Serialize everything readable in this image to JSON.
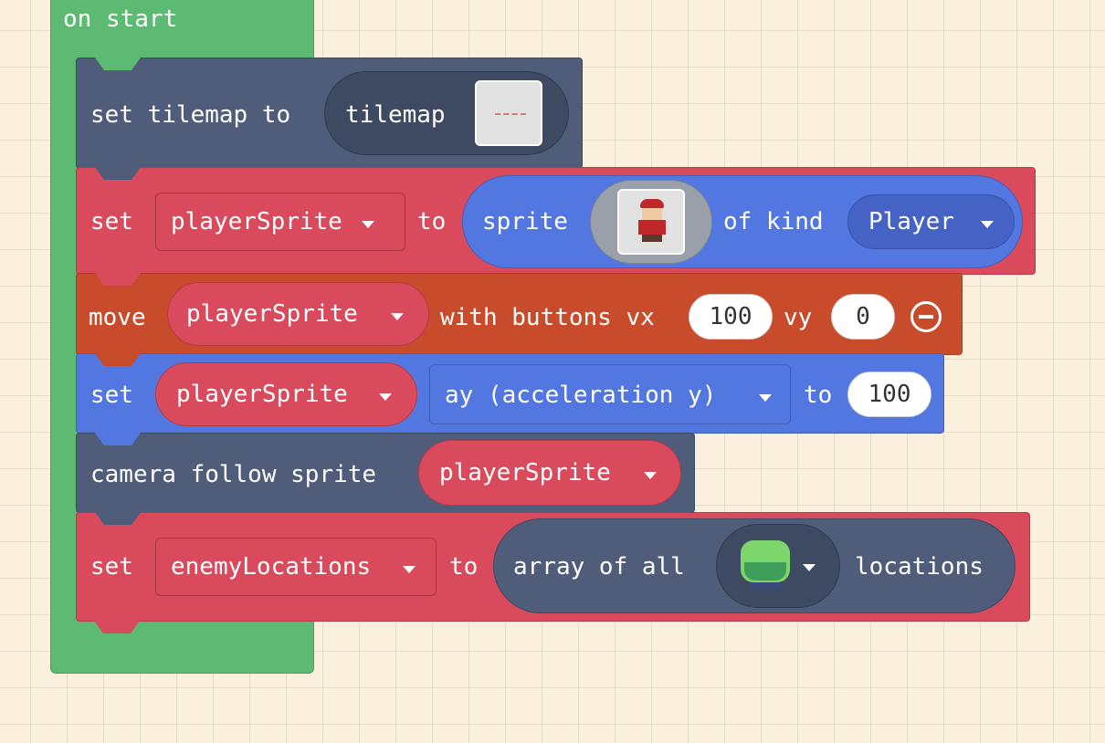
{
  "hat": {
    "label": "on start",
    "color": "#5cba73"
  },
  "blocks": {
    "tilemap": {
      "set_label": "set tilemap to",
      "value_label": "tilemap",
      "icon": "tilemap-thumbnail-icon"
    },
    "player_set": {
      "set_label": "set",
      "var": "playerSprite",
      "to_label": "to",
      "sprite_label": "sprite",
      "icon": "player-sprite-image-icon",
      "kind_label": "of kind",
      "kind": "Player"
    },
    "move": {
      "move_label": "move",
      "var": "playerSprite",
      "with_label": "with buttons vx",
      "vx": "100",
      "vy_label": "vy",
      "vy": "0",
      "icon": "minus-circle-icon"
    },
    "accel": {
      "set_label": "set",
      "var": "playerSprite",
      "prop": "ay (acceleration y)",
      "to_label": "to",
      "value": "100"
    },
    "camera": {
      "label": "camera follow sprite",
      "var": "playerSprite"
    },
    "enemies": {
      "set_label": "set",
      "var": "enemyLocations",
      "to_label": "to",
      "array_label": "array of all",
      "icon": "tree-tile-icon",
      "locations_label": "locations"
    }
  },
  "colors": {
    "green": "#5cba73",
    "slate": "#4f5d7a",
    "red": "#d84a5c",
    "blue": "#5377e1",
    "orange": "#c84b2b",
    "background": "#fbf0dd"
  }
}
